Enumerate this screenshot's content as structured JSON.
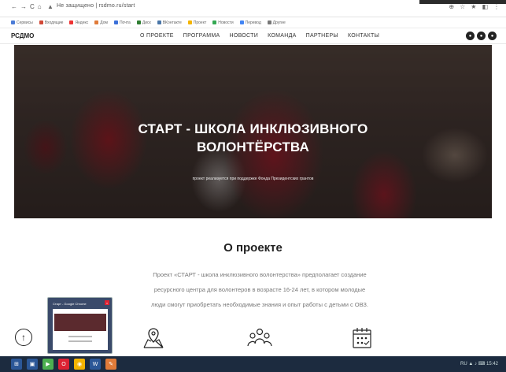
{
  "browser": {
    "nav": [
      "←",
      "→",
      "C",
      "⌂"
    ],
    "url": "Не защищено | rsdmo.ru/start",
    "right_icons": [
      "⊕",
      "☆",
      "★",
      "◧",
      "⋮"
    ],
    "bookmarks": [
      {
        "label": "Сервисы",
        "color": "#4a7bd6"
      },
      {
        "label": "Входящие",
        "color": "#d14836"
      },
      {
        "label": "Яндекс",
        "color": "#e33"
      },
      {
        "label": "Дом",
        "color": "#e07b39"
      },
      {
        "label": "Почта",
        "color": "#3a6fd8"
      },
      {
        "label": "Диск",
        "color": "#2e7d32"
      },
      {
        "label": "ВКонтакте",
        "color": "#4a76a8"
      },
      {
        "label": "Проект",
        "color": "#f4b400"
      },
      {
        "label": "Новости",
        "color": "#34a853"
      },
      {
        "label": "Перевод",
        "color": "#4285f4"
      },
      {
        "label": "Другие",
        "color": "#777"
      }
    ]
  },
  "site": {
    "logo": "РСДМО",
    "menu": [
      "О ПРОЕКТЕ",
      "ПРОГРАММА",
      "НОВОСТИ",
      "КОМАНДА",
      "ПАРТНЕРЫ",
      "КОНТАКТЫ"
    ],
    "socials": [
      "vk",
      "ok",
      "ig"
    ]
  },
  "hero": {
    "title_line1": "СТАРТ - ШКОЛА ИНКЛЮЗИВНОГО",
    "title_line2": "ВОЛОНТЁРСТВА",
    "subtitle": "проект реализуется при поддержке Фонда Президентских грантов"
  },
  "about": {
    "title": "О проекте",
    "line1": "Проект «СТАРТ - школа инклюзивного волонтерства» предполагает создание",
    "line2": "ресурсного центра для волонтеров в возрасте 16-24 лет, в котором молодые",
    "line3": "люди смогут приобретать необходимые знания и опыт работы с детьми с ОВЗ."
  },
  "features": [
    {
      "icon": "map-location-icon"
    },
    {
      "icon": "people-group-icon"
    },
    {
      "icon": "calendar-checklist-icon"
    }
  ],
  "scroll_up": "↑",
  "thumbnail": {
    "title": "Старт - Google Chrome",
    "close": "×"
  },
  "taskbar": {
    "items": [
      {
        "icon": "start-icon",
        "color": "#2b5797"
      },
      {
        "icon": "explorer-icon",
        "color": "#2b5797"
      },
      {
        "icon": "media-icon",
        "color": "#4caf50"
      },
      {
        "icon": "opera-icon",
        "color": "#d23"
      },
      {
        "icon": "chrome-icon",
        "color": "#f4b400"
      },
      {
        "icon": "word-icon",
        "color": "#2b5797"
      },
      {
        "icon": "paint-icon",
        "color": "#e07b39"
      }
    ],
    "tray": "RU ▲ ♪ ⌨ 15:42"
  }
}
